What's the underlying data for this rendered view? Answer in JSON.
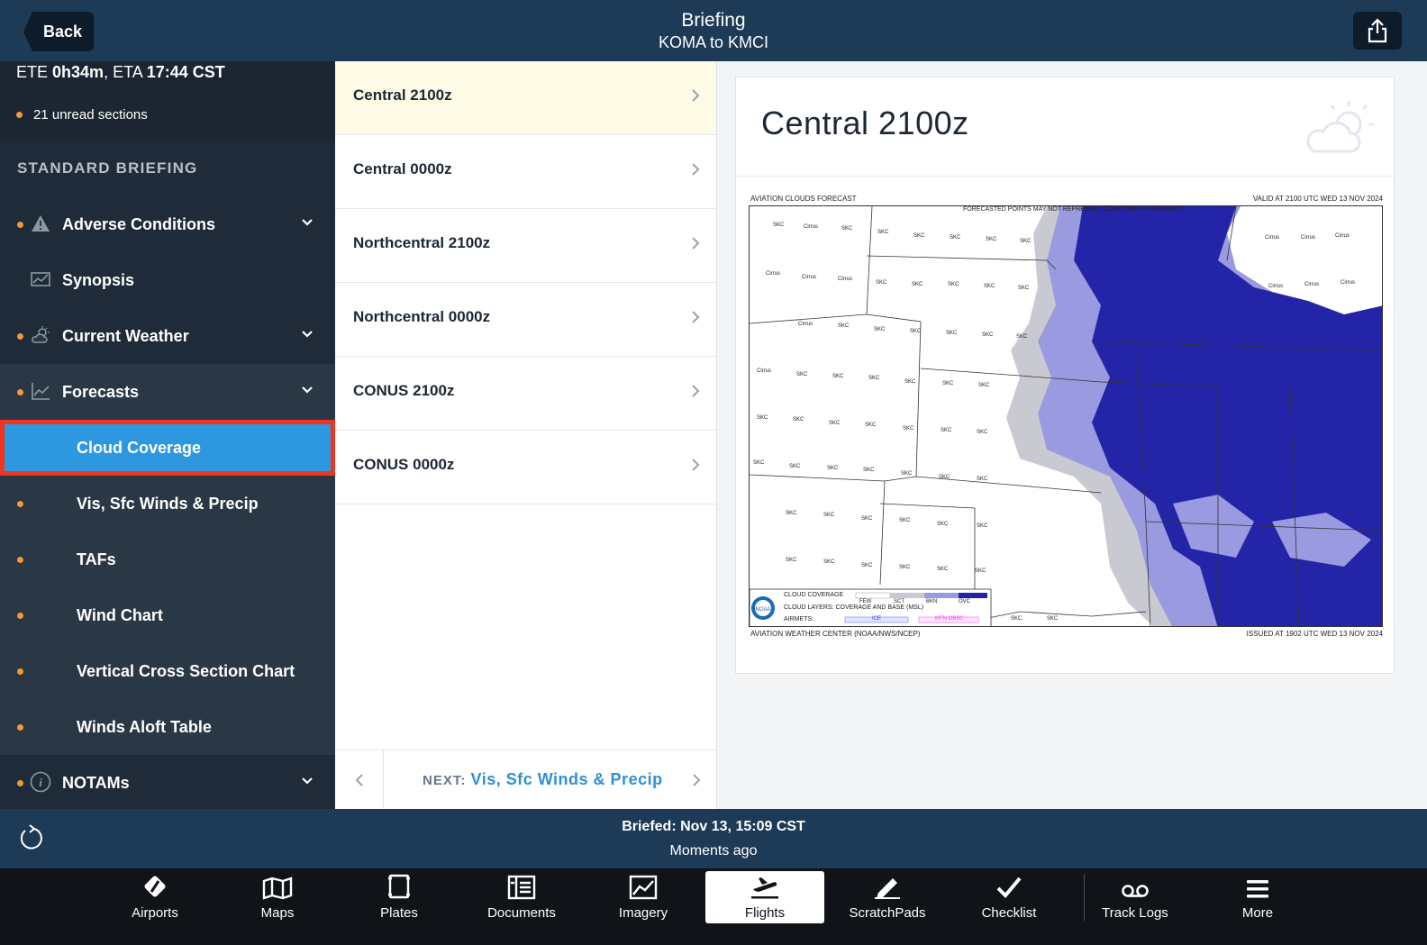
{
  "topbar": {
    "back_label": "Back",
    "title": "Briefing",
    "route": "KOMA to KMCI"
  },
  "sidebar": {
    "ete_prefix": "ETE ",
    "ete_value": "0h34m",
    "eta_prefix": ", ETA ",
    "eta_value": "17:44 CST",
    "unread": "21 unread sections",
    "section_title": "STANDARD BRIEFING",
    "items": [
      {
        "label": "Adverse Conditions",
        "icon": "warning-icon"
      },
      {
        "label": "Synopsis",
        "icon": "chart-image-icon"
      },
      {
        "label": "Current Weather",
        "icon": "sun-cloud-icon"
      },
      {
        "label": "Forecasts",
        "icon": "trend-chart-icon"
      },
      {
        "label": "Cloud Coverage"
      },
      {
        "label": "Vis, Sfc Winds & Precip"
      },
      {
        "label": "TAFs"
      },
      {
        "label": "Wind Chart"
      },
      {
        "label": "Vertical Cross Section Chart"
      },
      {
        "label": "Winds Aloft Table"
      },
      {
        "label": "NOTAMs",
        "icon": "info-icon"
      }
    ]
  },
  "midlist": {
    "items": [
      "Central 2100z",
      "Central 0000z",
      "Northcentral 2100z",
      "Northcentral 0000z",
      "CONUS 2100z",
      "CONUS 0000z"
    ],
    "next_prefix": "NEXT: ",
    "next_target": "Vis, Sfc Winds & Precip"
  },
  "content": {
    "title": "Central 2100z",
    "chart_header_left": "AVIATION CLOUDS FORECAST",
    "chart_header_mid": "FORECASTED POINTS MAY NOT REPRESENT CONDITION IN PROXIMITY",
    "chart_header_right": "VALID AT 2100 UTC WED 13 NOV 2024",
    "chart_footer_left": "AVIATION WEATHER CENTER (NOAA/NWS/NCEP)",
    "chart_footer_right": "ISSUED AT 1902 UTC WED 13 NOV 2024",
    "legend_coverage": "CLOUD COVERAGE",
    "legend_few": "FEW",
    "legend_sct": "SCT",
    "legend_bkn": "BKN",
    "legend_ovc": "OVC",
    "legend_layers": "CLOUD LAYERS: COVERAGE AND BASE (MSL)",
    "legend_airmets": "AIRMETS:",
    "legend_ice": "ICE",
    "legend_mtn": "MTN OBSC",
    "noaa_logo_text": "NOAA",
    "station_label": "SKC",
    "cirrus_label": "Cirrus",
    "colors": {
      "few": "#ffffff",
      "sct": "#c9c9d1",
      "bkn": "#9a9ae0",
      "ovc": "#2424a8"
    }
  },
  "status": {
    "briefed": "Briefed: Nov 13, 15:09 CST",
    "ago": "Moments ago"
  },
  "tabs": [
    {
      "label": "Airports",
      "icon": "airport-icon"
    },
    {
      "label": "Maps",
      "icon": "map-icon"
    },
    {
      "label": "Plates",
      "icon": "plates-icon"
    },
    {
      "label": "Documents",
      "icon": "documents-icon"
    },
    {
      "label": "Imagery",
      "icon": "imagery-icon"
    },
    {
      "label": "Flights",
      "icon": "flights-icon",
      "active": true
    },
    {
      "label": "ScratchPads",
      "icon": "pencil-icon"
    },
    {
      "label": "Checklist",
      "icon": "checkmark-icon"
    },
    {
      "label": "Track Logs",
      "icon": "voicemail-icon"
    },
    {
      "label": "More",
      "icon": "menu-icon"
    }
  ]
}
